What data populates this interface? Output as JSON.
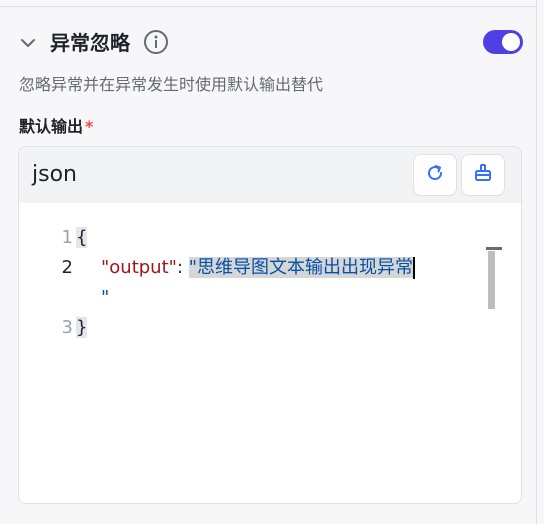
{
  "section": {
    "title": "异常忽略",
    "description": "忽略异常并在异常发生时使用默认输出替代",
    "toggle_on": true,
    "accent": "#4e40e5"
  },
  "field": {
    "label": "默认输出",
    "required_mark": "*"
  },
  "editor": {
    "language": "json",
    "line_numbers": [
      "1",
      "2",
      "3"
    ],
    "line1_brace": "{",
    "line2_key": "\"output\"",
    "line2_colon": ": ",
    "line2_value": "\"思维导图文本输出出现异常",
    "line2b_value": "\"",
    "line3_brace": "}"
  }
}
